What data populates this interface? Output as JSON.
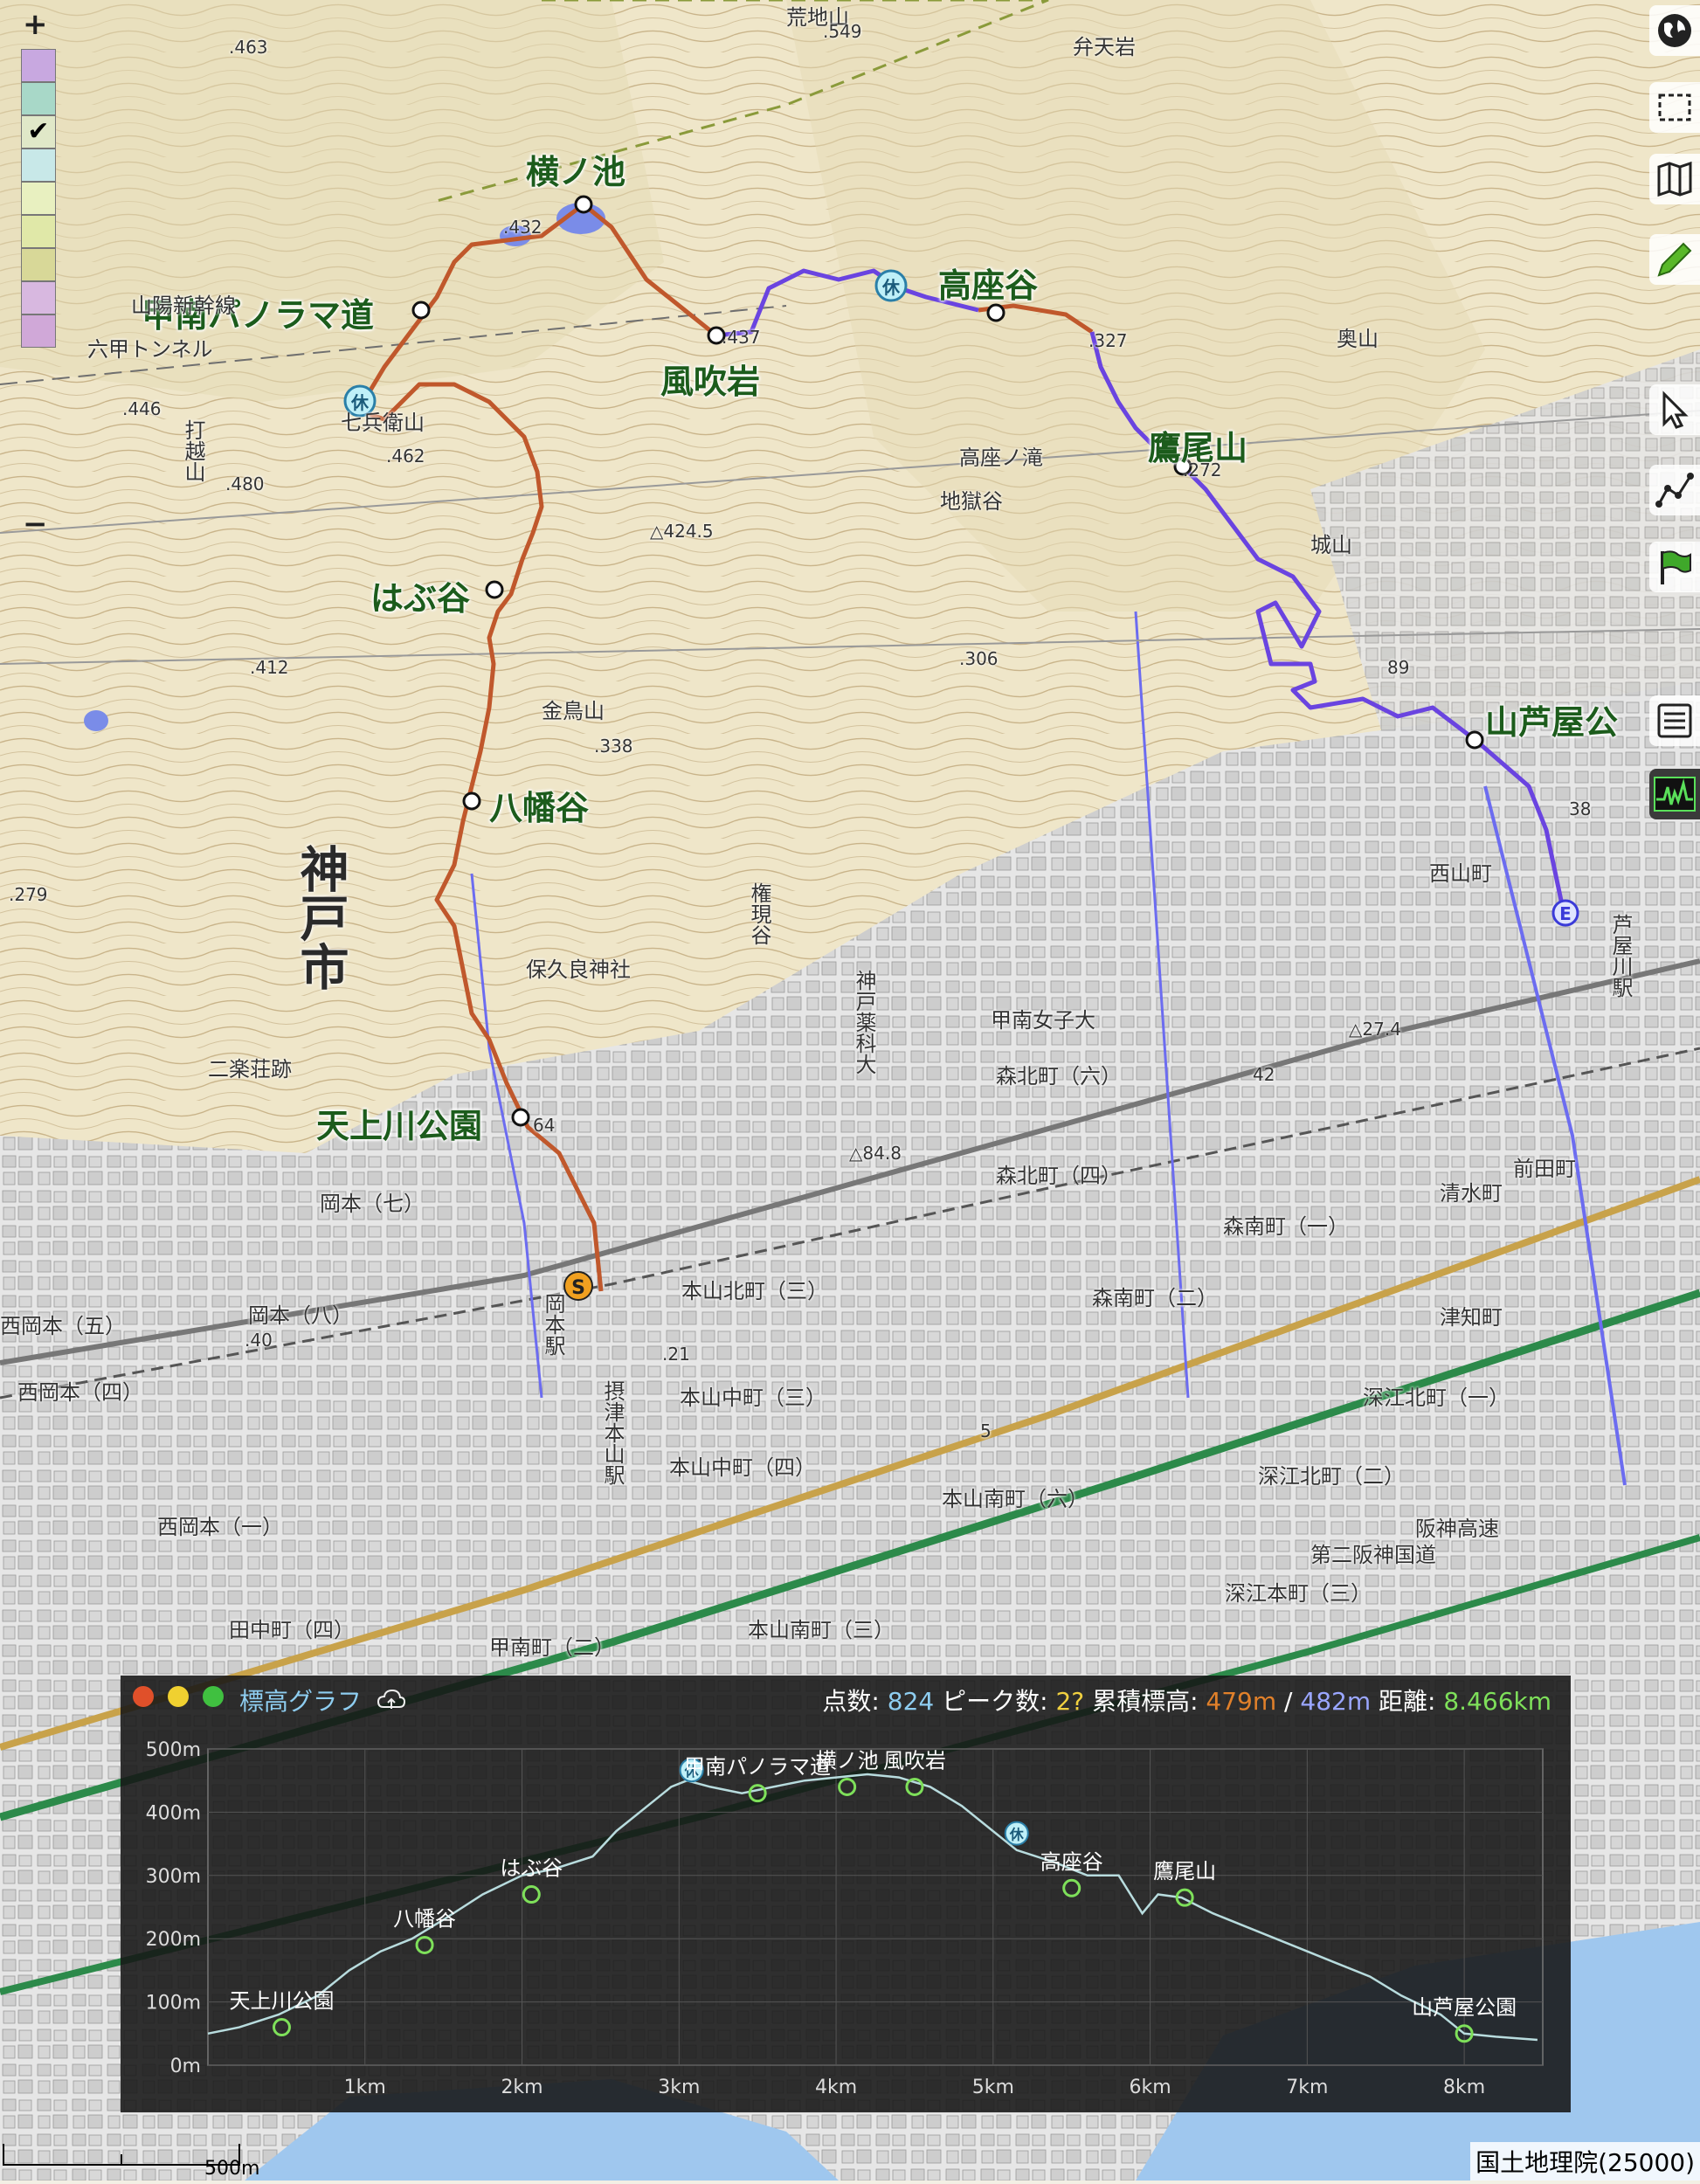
{
  "map": {
    "credit": "国土地理院(25000)",
    "scale_label": "500m",
    "zoom_in": "+",
    "zoom_out": "−",
    "city_label": "神戸市",
    "route_color_1": "#c0582c",
    "route_color_2": "#6a44e0",
    "waypoints": [
      {
        "name": "横ノ池",
        "kind": "waypoint"
      },
      {
        "name": "甲南パノラマ道",
        "kind": "waypoint"
      },
      {
        "name": "風吹岩",
        "kind": "waypoint"
      },
      {
        "name": "高座谷",
        "kind": "waypoint"
      },
      {
        "name": "鷹尾山",
        "kind": "waypoint"
      },
      {
        "name": "はぶ谷",
        "kind": "waypoint"
      },
      {
        "name": "八幡谷",
        "kind": "waypoint"
      },
      {
        "name": "天上川公園",
        "kind": "waypoint"
      },
      {
        "name": "山芦屋公",
        "kind": "waypoint"
      }
    ],
    "markers": {
      "start": "S",
      "end": "E",
      "rest": "休"
    },
    "place_labels": [
      {
        "text": "荒地山"
      },
      {
        "text": "弁天岩"
      },
      {
        "text": "七兵衛山"
      },
      {
        "text": "打越山"
      },
      {
        "text": "金鳥山"
      },
      {
        "text": "高座ノ滝"
      },
      {
        "text": "地獄谷"
      },
      {
        "text": "城山"
      },
      {
        "text": "奥山"
      },
      {
        "text": "保久良神社"
      },
      {
        "text": "二楽荘跡"
      },
      {
        "text": "権現谷"
      },
      {
        "text": "神戸薬科大"
      },
      {
        "text": "甲南女子大"
      },
      {
        "text": "森北町（六）"
      },
      {
        "text": "森北町（四）"
      },
      {
        "text": "本山北町（三）"
      },
      {
        "text": "本山中町（三）"
      },
      {
        "text": "本山中町（四）"
      },
      {
        "text": "本山南町（六）"
      },
      {
        "text": "本山南町（三）"
      },
      {
        "text": "森南町（一）"
      },
      {
        "text": "森南町（二）"
      },
      {
        "text": "深江北町（一）"
      },
      {
        "text": "深江北町（二）"
      },
      {
        "text": "深江本町（三）"
      },
      {
        "text": "岡本（七）"
      },
      {
        "text": "岡本（八）"
      },
      {
        "text": "西岡本（五）"
      },
      {
        "text": "西岡本（四）"
      },
      {
        "text": "西岡本（一）"
      },
      {
        "text": "田中町（四）"
      },
      {
        "text": "甲南町（二）"
      },
      {
        "text": "清水町"
      },
      {
        "text": "前田町"
      },
      {
        "text": "津知町"
      },
      {
        "text": "西山町"
      },
      {
        "text": "芦屋川駅"
      },
      {
        "text": "岡本駅"
      },
      {
        "text": "摂津本山駅"
      },
      {
        "text": "第二阪神国道"
      },
      {
        "text": "阪神高速"
      },
      {
        "text": "六甲トンネル"
      },
      {
        "text": "山陽新幹線"
      }
    ],
    "spot_heights": [
      ".463",
      ".549",
      ".432",
      ".437",
      ".327",
      ".272",
      ".446",
      ".462",
      ".480",
      "△424.5",
      ".412",
      ".338",
      ".306",
      ".279",
      "89",
      "38",
      "64",
      ".40",
      ".21",
      "△84.8",
      "42",
      "△27.4",
      "5"
    ]
  },
  "toolbar": {
    "items": [
      "globe-icon",
      "select-area-icon",
      "map-icon",
      "pencil-icon",
      "pointer-icon",
      "polyline-icon",
      "flag-icon",
      "list-icon",
      "elevation-graph-icon"
    ]
  },
  "graph": {
    "title": "標高グラフ",
    "stats": {
      "points_label": "点数:",
      "points": "824",
      "peaks_label": "ピーク数:",
      "peaks": "2?",
      "cum_label": "累積標高:",
      "cum_up": "479m",
      "sep": "/",
      "cum_down": "482m",
      "dist_label": "距離:",
      "dist": "8.466km"
    },
    "colors": {
      "up": "#e0802a",
      "down": "#9aa6ff",
      "dist": "#7ee05a",
      "title": "#8ecdf0"
    }
  },
  "chart_data": {
    "type": "line",
    "title": "標高グラフ",
    "xlabel": "",
    "ylabel": "",
    "x_unit": "km",
    "xlim": [
      0,
      8.5
    ],
    "ylim": [
      0,
      500
    ],
    "x_ticks": [
      {
        "v": 1,
        "label": "1km"
      },
      {
        "v": 2,
        "label": "2km"
      },
      {
        "v": 3,
        "label": "3km"
      },
      {
        "v": 4,
        "label": "4km"
      },
      {
        "v": 5,
        "label": "5km"
      },
      {
        "v": 6,
        "label": "6km"
      },
      {
        "v": 7,
        "label": "7km"
      },
      {
        "v": 8,
        "label": "8km"
      }
    ],
    "y_ticks": [
      {
        "v": 0,
        "label": "0m"
      },
      {
        "v": 100,
        "label": "100m"
      },
      {
        "v": 200,
        "label": "200m"
      },
      {
        "v": 300,
        "label": "300m"
      },
      {
        "v": 400,
        "label": "400m"
      },
      {
        "v": 500,
        "label": "500m"
      }
    ],
    "grid": true,
    "series": [
      {
        "x": [
          0,
          0.2,
          0.45,
          0.7,
          0.9,
          1.1,
          1.3,
          1.5,
          1.75,
          2.0,
          2.2,
          2.45,
          2.6,
          2.8,
          2.95,
          3.05,
          3.2,
          3.4,
          3.6,
          3.8,
          4.0,
          4.2,
          4.4,
          4.6,
          4.8,
          5.0,
          5.15,
          5.4,
          5.6,
          5.8,
          5.95,
          6.05,
          6.2,
          6.4,
          6.6,
          6.8,
          7.0,
          7.2,
          7.4,
          7.6,
          7.85,
          8.0,
          8.2,
          8.466
        ],
        "y": [
          50,
          60,
          80,
          110,
          150,
          180,
          200,
          230,
          270,
          300,
          310,
          330,
          370,
          410,
          440,
          450,
          440,
          430,
          440,
          450,
          455,
          460,
          455,
          440,
          410,
          370,
          340,
          320,
          300,
          300,
          240,
          270,
          265,
          240,
          220,
          200,
          180,
          160,
          140,
          110,
          80,
          50,
          45,
          40
        ]
      }
    ],
    "annotations": [
      {
        "x": 0.47,
        "y": 60,
        "label": "天上川公園",
        "kind": "waypoint"
      },
      {
        "x": 1.38,
        "y": 190,
        "label": "八幡谷",
        "kind": "waypoint"
      },
      {
        "x": 2.06,
        "y": 270,
        "label": "はぶ谷",
        "kind": "waypoint"
      },
      {
        "x": 3.08,
        "y": 450,
        "label": "",
        "kind": "rest"
      },
      {
        "x": 3.5,
        "y": 430,
        "label": "甲南パノラマ道",
        "kind": "waypoint"
      },
      {
        "x": 4.07,
        "y": 440,
        "label": "横ノ池",
        "kind": "waypoint"
      },
      {
        "x": 4.5,
        "y": 440,
        "label": "風吹岩",
        "kind": "waypoint"
      },
      {
        "x": 5.15,
        "y": 350,
        "label": "",
        "kind": "rest"
      },
      {
        "x": 5.5,
        "y": 280,
        "label": "高座谷",
        "kind": "waypoint"
      },
      {
        "x": 6.22,
        "y": 265,
        "label": "鷹尾山",
        "kind": "waypoint"
      },
      {
        "x": 8.0,
        "y": 50,
        "label": "山芦屋公園",
        "kind": "waypoint"
      }
    ]
  }
}
